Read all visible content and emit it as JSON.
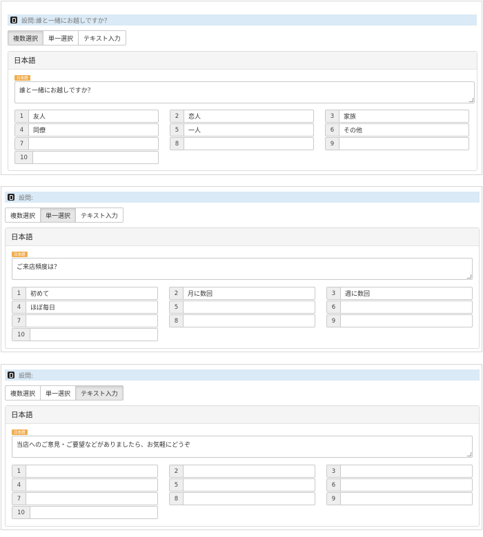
{
  "tabs": [
    "複数選択",
    "単一選択",
    "テキスト入力"
  ],
  "panel_title": "日本語",
  "lang_badge": "日本語",
  "questions": [
    {
      "header": "設問:誰と一緒にお越しですか？",
      "active_tab": 0,
      "question_text": "誰と一緒にお越しですか？",
      "options": [
        {
          "n": "1",
          "v": "友人"
        },
        {
          "n": "2",
          "v": "恋人"
        },
        {
          "n": "3",
          "v": "家族"
        },
        {
          "n": "4",
          "v": "同僚"
        },
        {
          "n": "5",
          "v": "一人"
        },
        {
          "n": "6",
          "v": "その他"
        },
        {
          "n": "7",
          "v": ""
        },
        {
          "n": "8",
          "v": ""
        },
        {
          "n": "9",
          "v": ""
        },
        {
          "n": "10",
          "v": ""
        }
      ]
    },
    {
      "header": "設問:",
      "active_tab": 1,
      "question_text": "ご来店頻度は？",
      "options": [
        {
          "n": "1",
          "v": "初めて"
        },
        {
          "n": "2",
          "v": "月に数回"
        },
        {
          "n": "3",
          "v": "週に数回"
        },
        {
          "n": "4",
          "v": "ほぼ毎日"
        },
        {
          "n": "5",
          "v": ""
        },
        {
          "n": "6",
          "v": ""
        },
        {
          "n": "7",
          "v": ""
        },
        {
          "n": "8",
          "v": ""
        },
        {
          "n": "9",
          "v": ""
        },
        {
          "n": "10",
          "v": ""
        }
      ]
    },
    {
      "header": "設問:",
      "active_tab": 2,
      "question_text": "当店へのご意見・ご要望などがありましたら、お気軽にどうぞ",
      "options": [
        {
          "n": "1",
          "v": ""
        },
        {
          "n": "2",
          "v": ""
        },
        {
          "n": "3",
          "v": ""
        },
        {
          "n": "4",
          "v": ""
        },
        {
          "n": "5",
          "v": ""
        },
        {
          "n": "6",
          "v": ""
        },
        {
          "n": "7",
          "v": ""
        },
        {
          "n": "8",
          "v": ""
        },
        {
          "n": "9",
          "v": ""
        },
        {
          "n": "10",
          "v": ""
        }
      ]
    }
  ]
}
